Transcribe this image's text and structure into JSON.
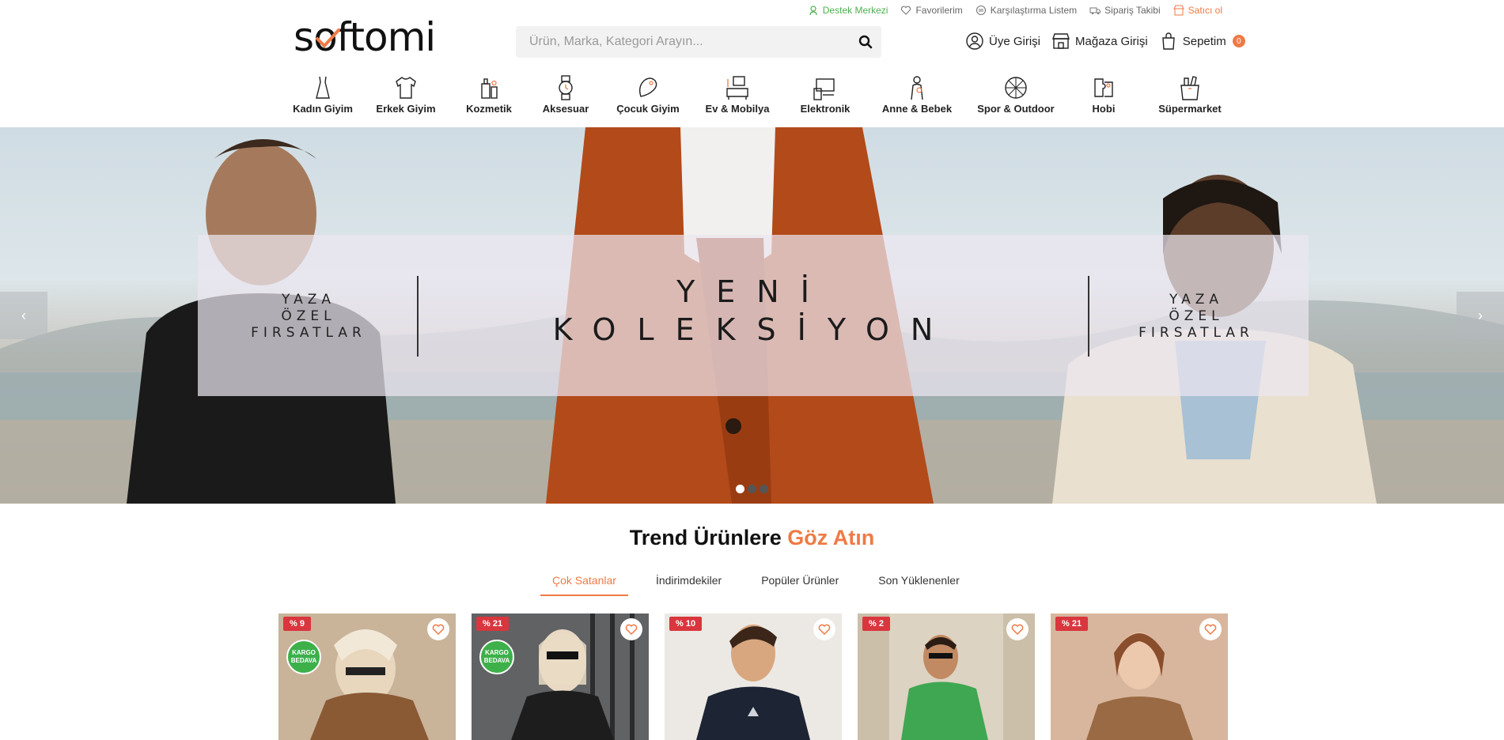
{
  "topbar": {
    "links": [
      {
        "label": "Destek Merkezi"
      },
      {
        "label": "Favorilerim"
      },
      {
        "label": "Karşılaştırma Listem"
      },
      {
        "label": "Sipariş Takibi"
      },
      {
        "label": "Satıcı ol"
      }
    ]
  },
  "logo": {
    "text_pre": "s",
    "text_post": "ftomi",
    "check_color": "#ef7a45"
  },
  "search": {
    "placeholder": "Ürün, Marka, Kategori Arayın..."
  },
  "user_actions": {
    "login": "Üye Girişi",
    "store_login": "Mağaza Girişi",
    "cart": "Sepetim",
    "cart_count": "0"
  },
  "categories": [
    {
      "label": "Kadın Giyim",
      "icon": "dress-icon"
    },
    {
      "label": "Erkek Giyim",
      "icon": "shirt-icon"
    },
    {
      "label": "Kozmetik",
      "icon": "cosmetics-icon"
    },
    {
      "label": "Aksesuar",
      "icon": "watch-icon"
    },
    {
      "label": "Çocuk Giyim",
      "icon": "child-clothing-icon"
    },
    {
      "label": "Ev & Mobilya",
      "icon": "furniture-icon"
    },
    {
      "label": "Elektronik",
      "icon": "electronics-icon"
    },
    {
      "label": "Anne & Bebek",
      "icon": "mother-baby-icon"
    },
    {
      "label": "Spor & Outdoor",
      "icon": "sports-icon"
    },
    {
      "label": "Hobi",
      "icon": "hobby-icon"
    },
    {
      "label": "Süpermarket",
      "icon": "supermarket-icon"
    }
  ],
  "hero": {
    "side_left": [
      "YAZA",
      "ÖZEL",
      "FIRSATLAR"
    ],
    "side_right": [
      "YAZA",
      "ÖZEL",
      "FIRSATLAR"
    ],
    "main": [
      "YENİ",
      "KOLEKSİYON"
    ],
    "prev_symbol": "‹",
    "next_symbol": "›",
    "slide_count": 3,
    "active_slide": 1
  },
  "trend": {
    "title_main": "Trend Ürünlere",
    "title_accent": "Göz Atın",
    "accent_color": "#ef7a45",
    "tabs": [
      {
        "label": "Çok Satanlar",
        "active": true
      },
      {
        "label": "İndirimdekiler",
        "active": false
      },
      {
        "label": "Popüler Ürünler",
        "active": false
      },
      {
        "label": "Son Yüklenenler",
        "active": false
      }
    ]
  },
  "products": [
    {
      "discount": "% 9",
      "kargo": "KARGO BEDAVA"
    },
    {
      "discount": "% 21",
      "kargo": "KARGO BEDAVA"
    },
    {
      "discount": "% 10",
      "kargo": ""
    },
    {
      "discount": "% 2",
      "kargo": ""
    },
    {
      "discount": "% 21",
      "kargo": ""
    }
  ]
}
